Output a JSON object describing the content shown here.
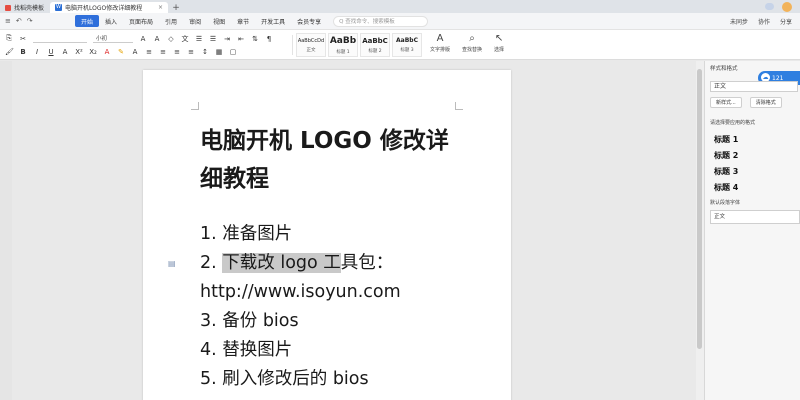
{
  "tabs": [
    {
      "label": "找稻壳模板"
    },
    {
      "label": "电脑开机LOGO修改详细教程",
      "close": "×"
    }
  ],
  "new_tab": "+",
  "menu": {
    "quick_access": [
      "≡",
      "↶",
      "↷"
    ],
    "items": [
      "开始",
      "插入",
      "页面布局",
      "引用",
      "审阅",
      "视图",
      "章节",
      "开发工具",
      "会员专享"
    ],
    "search_placeholder": "Q 查找命令、搜索模板",
    "right": [
      "未同步",
      "协作",
      "分享"
    ]
  },
  "ribbon": {
    "font_name": "",
    "font_size": "小初",
    "styles": [
      {
        "sample": "AaBbCcDd",
        "name": "正文"
      },
      {
        "sample": "AaBb",
        "name": "标题 1"
      },
      {
        "sample": "AaBbC",
        "name": "标题 2"
      },
      {
        "sample": "AaBbC",
        "name": "标题 3"
      }
    ],
    "tools": [
      {
        "glyph": "A",
        "label": "文字排版"
      },
      {
        "glyph": "⌕",
        "label": "查找替换"
      },
      {
        "glyph": "↖",
        "label": "选择"
      }
    ]
  },
  "document": {
    "title": "电脑开机 LOGO 修改详细教程",
    "list": [
      "1. 准备图片",
      "2. 下载改 logo 工具包：",
      "http://www.isoyun.com",
      "3. 备份 bios",
      "4. 替换图片",
      "5. 刷入修改后的 bios"
    ],
    "highlighted_prefix": "2. ",
    "highlighted_text": "下载改 logo 工",
    "highlighted_suffix": "具包："
  },
  "panel": {
    "header": "样式和格式",
    "cloud_label": "121",
    "current_style": "正文",
    "new_style_button": "新样式...",
    "clear_format_button": "清除格式",
    "apply_label": "请选择要应用的格式",
    "styles": [
      "标题 1",
      "标题 2",
      "标题 3",
      "标题 4"
    ],
    "default_label": "默认段落字体",
    "bottom_field": "正文"
  },
  "colors": {
    "accent": "#2f6fdb",
    "highlight": "#c9c9c9"
  }
}
